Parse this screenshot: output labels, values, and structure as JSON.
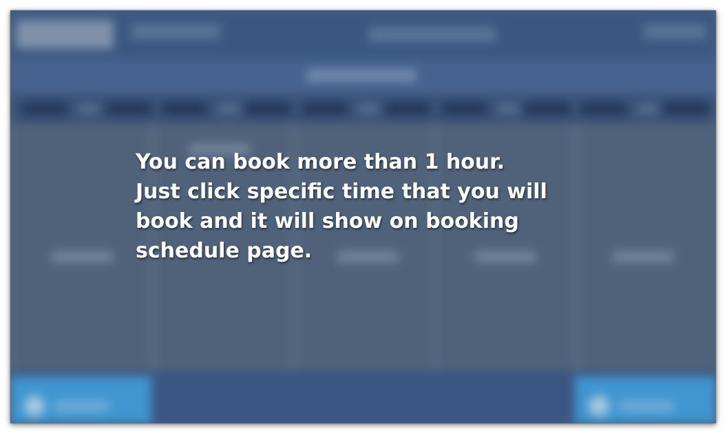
{
  "tutorial_overlay": {
    "lines": [
      "You can book more than 1 hour.",
      "Just click specific time that you will",
      "book and it will show on booking",
      "schedule page."
    ]
  },
  "colors": {
    "topbar": "#3d5c87",
    "footer": "#3d5a88",
    "action_button": "#43a3e0",
    "grid": "#56687e",
    "overlay_text": "#ffffff"
  }
}
